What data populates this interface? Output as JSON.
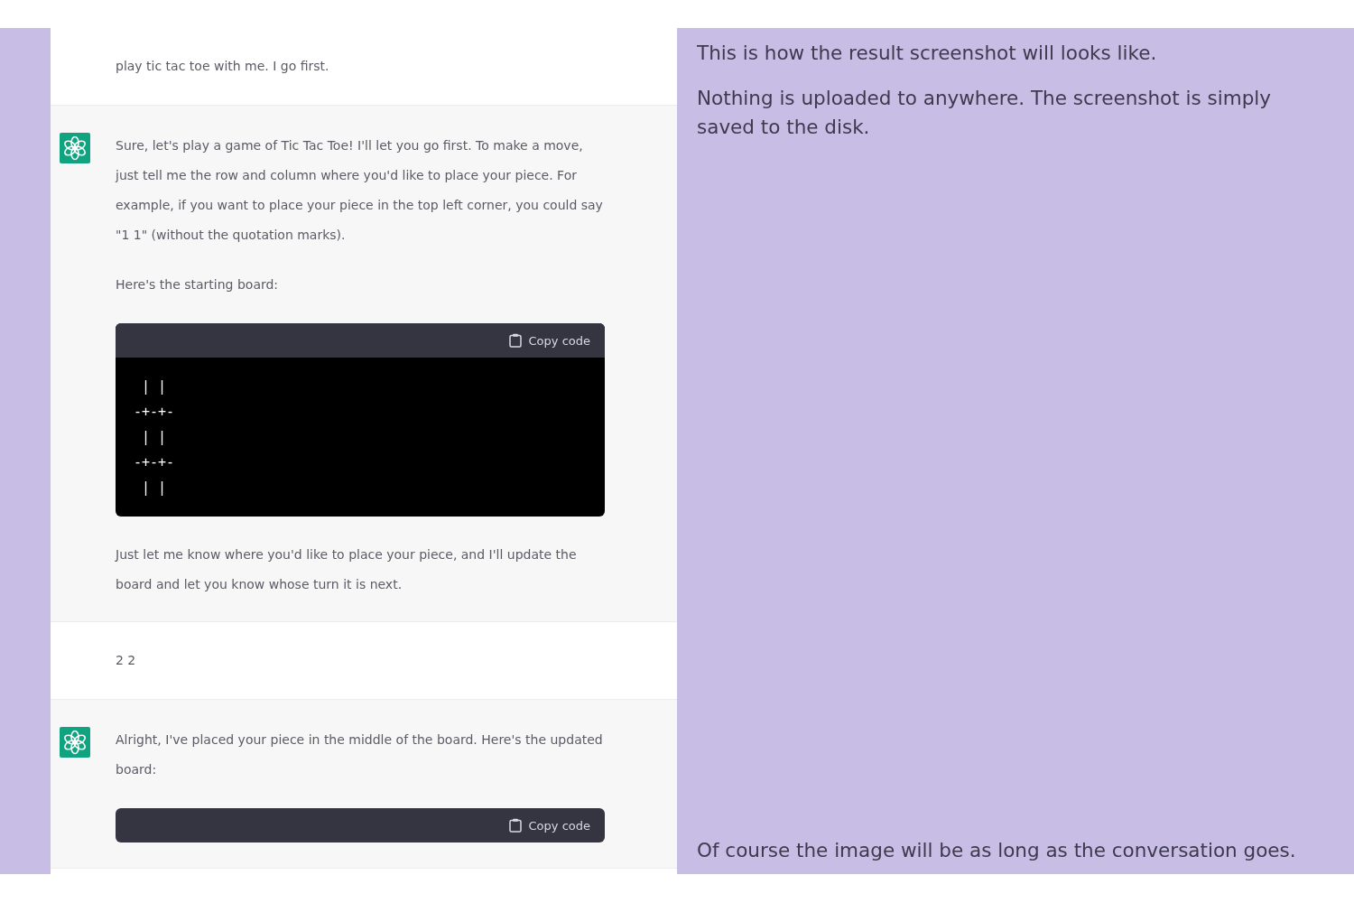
{
  "chat": {
    "messages": [
      {
        "kind": "user",
        "blocks": [
          {
            "kind": "text",
            "text": "play tic tac toe with me. I go first."
          }
        ]
      },
      {
        "kind": "assistant",
        "blocks": [
          {
            "kind": "text",
            "text": "Sure, let's play a game of Tic Tac Toe! I'll let you go first. To make a move, just tell me the row and column where you'd like to place your piece. For example, if you want to place your piece in the top left corner, you could say \"1 1\" (without the quotation marks)."
          },
          {
            "kind": "text",
            "text": "Here's the starting board:"
          },
          {
            "kind": "code",
            "button": "Copy code",
            "lines": [
              " | |",
              "-+-+-",
              " | |",
              "-+-+-",
              " | |"
            ]
          },
          {
            "kind": "text",
            "text": "Just let me know where you'd like to place your piece, and I'll update the board and let you know whose turn it is next."
          }
        ]
      },
      {
        "kind": "user",
        "blocks": [
          {
            "kind": "text",
            "text": "2 2"
          }
        ]
      },
      {
        "kind": "assistant",
        "blocks": [
          {
            "kind": "text",
            "text": "Alright, I've placed your piece in the middle of the board. Here's the updated board:"
          },
          {
            "kind": "code",
            "button": "Copy code"
          }
        ]
      }
    ]
  },
  "notes_top": [
    "This is how the result screenshot will looks like.",
    "Nothing is uploaded to anywhere. The screenshot is simply saved to the disk."
  ],
  "notes_bottom": [
    "Of course the image will be as long as the conversation goes."
  ]
}
